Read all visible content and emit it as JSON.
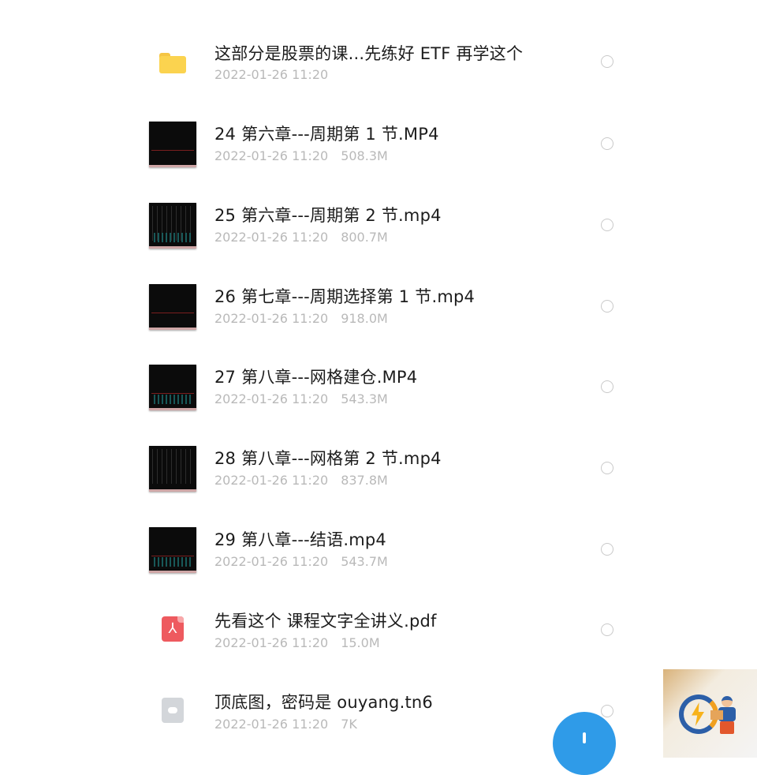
{
  "files": [
    {
      "title": "这部分是股票的课...先练好 ETF 再学这个",
      "date": "2022-01-26 11:20",
      "size": "",
      "icon": "folder-icon"
    },
    {
      "title": "24 第六章---周期第 1 节.MP4",
      "date": "2022-01-26 11:20",
      "size": "508.3M",
      "icon": "video-thumbnail"
    },
    {
      "title": "25 第六章---周期第 2 节.mp4",
      "date": "2022-01-26 11:20",
      "size": "800.7M",
      "icon": "video-thumbnail"
    },
    {
      "title": "26 第七章---周期选择第 1 节.mp4",
      "date": "2022-01-26 11:20",
      "size": "918.0M",
      "icon": "video-thumbnail"
    },
    {
      "title": "27 第八章---网格建仓.MP4",
      "date": "2022-01-26 11:20",
      "size": "543.3M",
      "icon": "video-thumbnail"
    },
    {
      "title": "28 第八章---网格第 2 节.mp4",
      "date": "2022-01-26 11:20",
      "size": "837.8M",
      "icon": "video-thumbnail"
    },
    {
      "title": "29 第八章---结语.mp4",
      "date": "2022-01-26 11:20",
      "size": "543.7M",
      "icon": "video-thumbnail"
    },
    {
      "title": "先看这个 课程文字全讲义.pdf",
      "date": "2022-01-26 11:20",
      "size": "15.0M",
      "icon": "pdf-icon"
    },
    {
      "title": "顶底图，密码是 ouyang.tn6",
      "date": "2022-01-26 11:20",
      "size": "7K",
      "icon": "cloud-file-icon"
    }
  ],
  "colors": {
    "folder": "#fbd34f",
    "pdf": "#ee5a5f",
    "fab": "#2f9be8",
    "meta_text": "#b9b9b9"
  }
}
